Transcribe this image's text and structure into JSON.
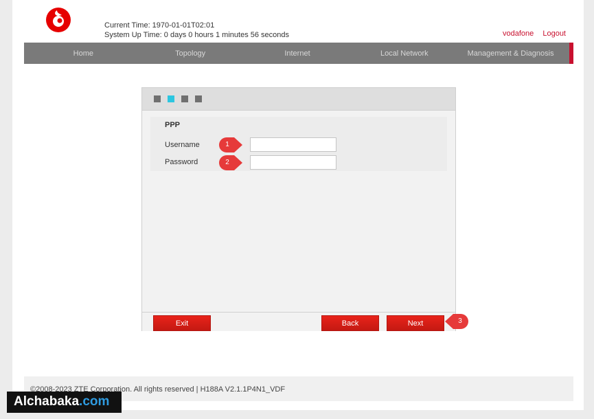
{
  "header": {
    "current_time": "Current Time: 1970-01-01T02:01",
    "uptime": "System Up Time:  0 days 0 hours 1 minutes 56 seconds",
    "user": "vodafone",
    "logout": "Logout"
  },
  "nav": {
    "items": [
      {
        "label": "Home"
      },
      {
        "label": "Topology"
      },
      {
        "label": "Internet"
      },
      {
        "label": "Local Network"
      },
      {
        "label": "Management & Diagnosis"
      }
    ]
  },
  "wizard": {
    "steps_total": 4,
    "active_step": 2,
    "section_title": "PPP",
    "username_label": "Username",
    "username_value": "",
    "password_label": "Password",
    "password_value": "",
    "exit_label": "Exit",
    "back_label": "Back",
    "next_label": "Next"
  },
  "markers": [
    "1",
    "2",
    "3"
  ],
  "footer": {
    "copyright": "©2008-2023 ZTE Corporation. All rights reserved  |   H188A V2.1.1P4N1_VDF"
  },
  "watermark": {
    "name": "Alchabaka",
    "suffix": ".com"
  },
  "colors": {
    "brand_red": "#e60000",
    "nav_gray": "#7a7a7a",
    "active_step": "#2cc6e0",
    "marker_red": "#e63a3a"
  }
}
